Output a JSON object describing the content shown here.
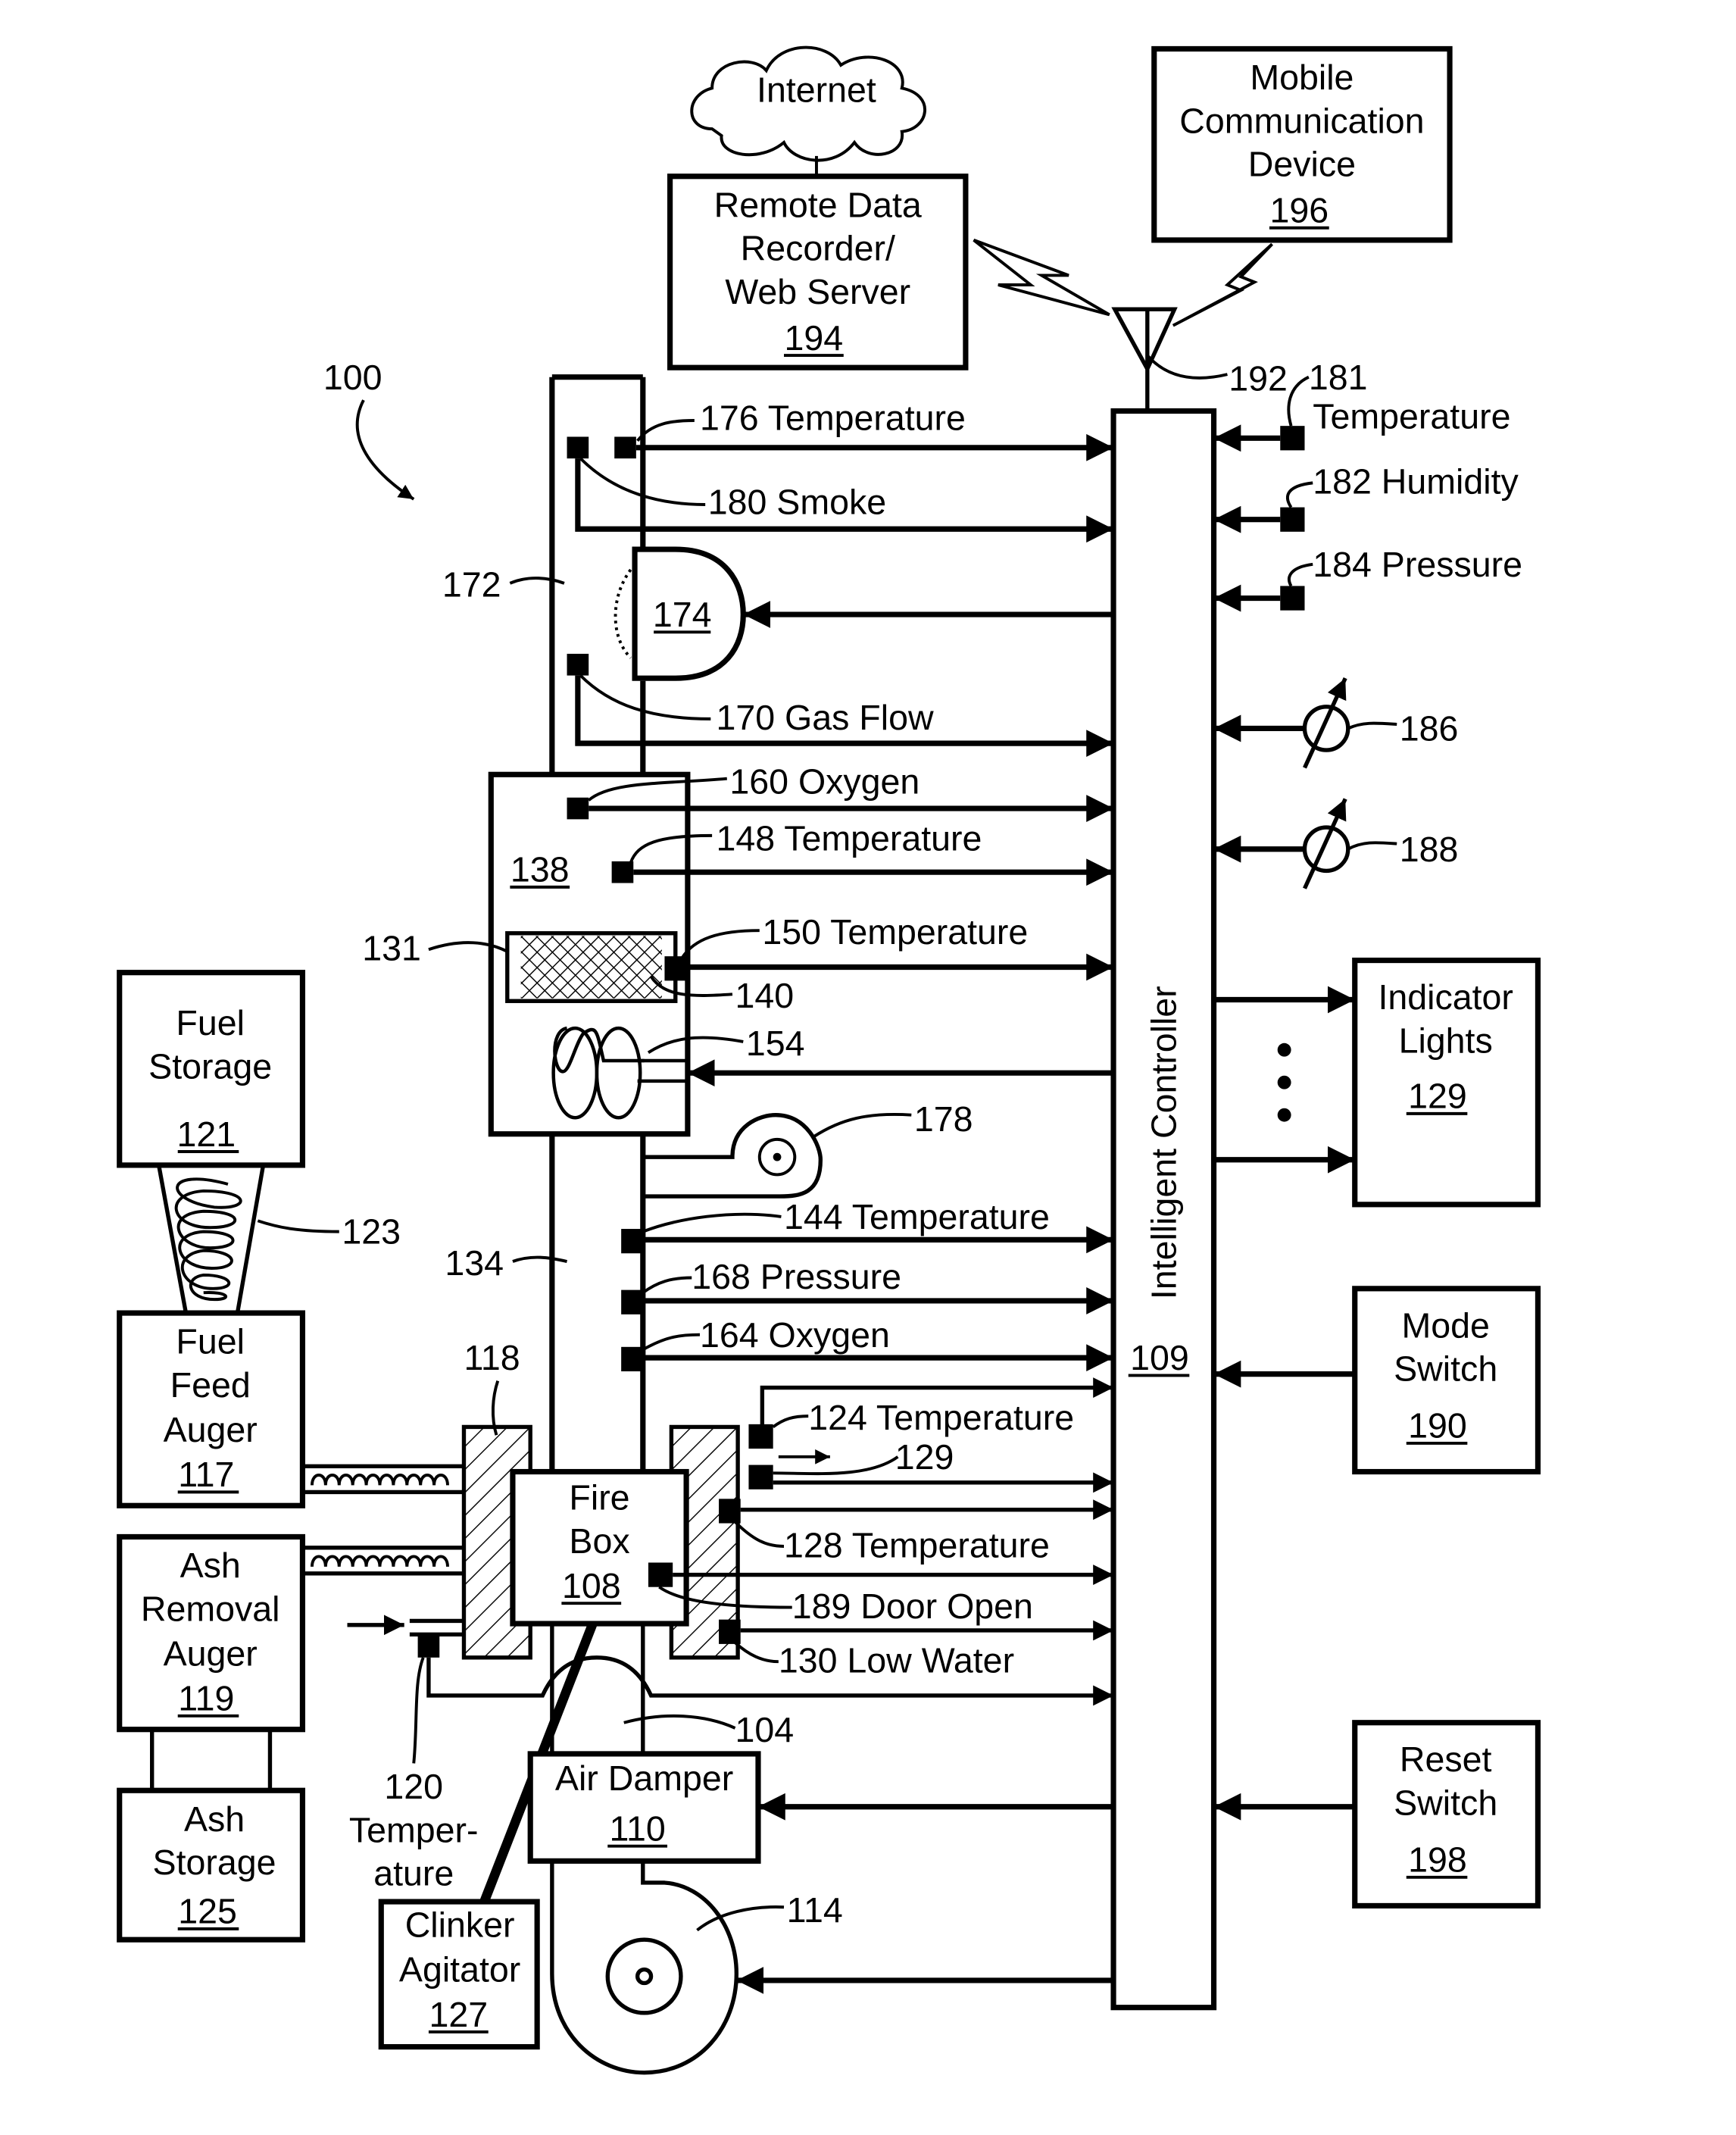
{
  "figure": {
    "ref": "100",
    "controller": {
      "label": "Intelligent Controller",
      "ref": "109"
    },
    "blocks": {
      "internet": {
        "label": "Internet"
      },
      "remote": {
        "lines": [
          "Remote Data",
          "Recorder/",
          "Web Server"
        ],
        "ref": "194"
      },
      "mobile": {
        "lines": [
          "Mobile",
          "Communication",
          "Device"
        ],
        "ref": "196"
      },
      "indicator": {
        "lines": [
          "Indicator",
          "Lights"
        ],
        "ref": "129"
      },
      "mode": {
        "lines": [
          "Mode",
          "Switch"
        ],
        "ref": "190"
      },
      "reset": {
        "lines": [
          "Reset",
          "Switch"
        ],
        "ref": "198"
      },
      "fuel_storage": {
        "lines": [
          "Fuel",
          "Storage"
        ],
        "ref": "121"
      },
      "fuel_feed": {
        "lines": [
          "Fuel",
          "Feed",
          "Auger"
        ],
        "ref": "117"
      },
      "ash_removal": {
        "lines": [
          "Ash",
          "Removal",
          "Auger"
        ],
        "ref": "119"
      },
      "ash_storage": {
        "lines": [
          "Ash",
          "Storage"
        ],
        "ref": "125"
      },
      "fire_box": {
        "lines": [
          "Fire",
          "Box"
        ],
        "ref": "108"
      },
      "air_damper": {
        "lines": [
          "Air Damper"
        ],
        "ref": "110"
      },
      "clinker": {
        "lines": [
          "Clinker",
          "Agitator"
        ],
        "ref": "127"
      },
      "heat_exchanger": {
        "ref": "138"
      },
      "damper_174": {
        "ref": "174"
      }
    },
    "sensors": {
      "s176": "176 Temperature",
      "s180": "180 Smoke",
      "s170": "170 Gas Flow",
      "s160": "160 Oxygen",
      "s148": "148 Temperature",
      "s150": "150 Temperature",
      "s144": "144 Temperature",
      "s168": "168 Pressure",
      "s164": "164 Oxygen",
      "s124": "124 Temperature",
      "s128": "128 Temperature",
      "s189": "189 Door Open",
      "s130": "130 Low Water",
      "s181_num": "181",
      "s181_label": "Temperature",
      "s182": "182  Humidity",
      "s184": "184  Pressure",
      "s120_lines": [
        "120",
        "Temper-",
        "ature"
      ]
    },
    "refs": {
      "r192": "192",
      "r186": "186",
      "r188": "188",
      "r172": "172",
      "r131": "131",
      "r140": "140",
      "r154": "154",
      "r178": "178",
      "r123": "123",
      "r134": "134",
      "r118": "118",
      "r129b": "129",
      "r104": "104",
      "r114": "114"
    }
  }
}
